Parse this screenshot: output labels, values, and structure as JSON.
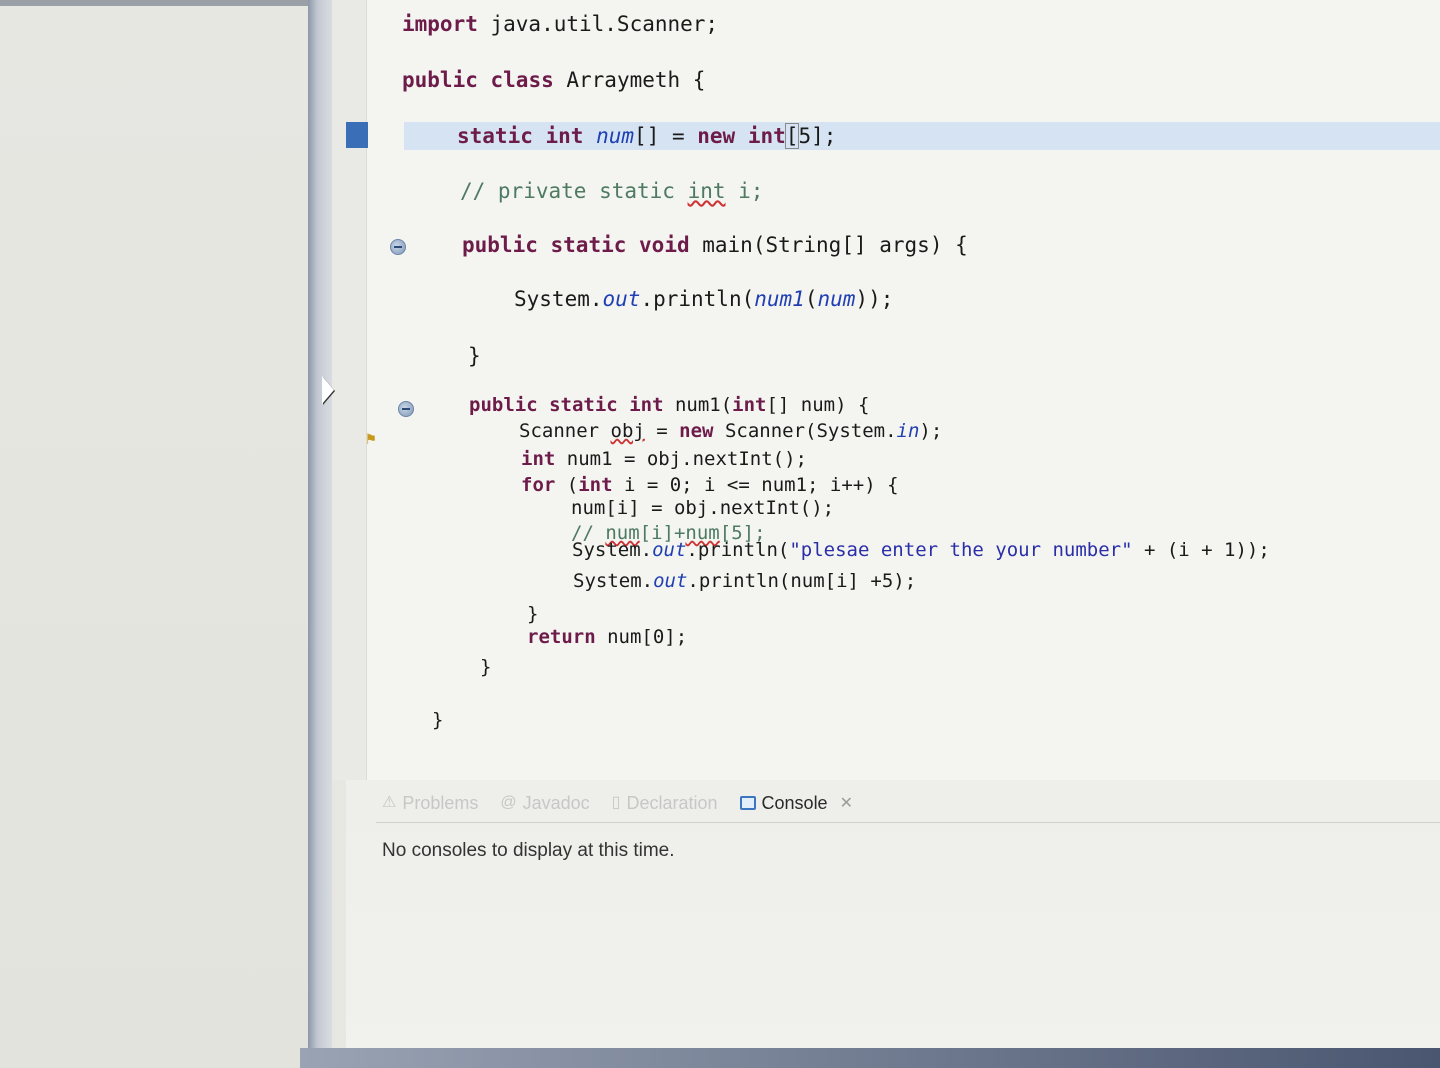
{
  "editor": {
    "lines": [
      {
        "id": "l1",
        "segments": [
          {
            "t": "import",
            "c": "kw"
          },
          {
            "t": " java.util.Scanner;",
            "c": ""
          }
        ]
      },
      {
        "id": "l2",
        "segments": [
          {
            "t": "public",
            "c": "kw"
          },
          {
            "t": " ",
            "c": ""
          },
          {
            "t": "class",
            "c": "kw"
          },
          {
            "t": " Arraymeth {",
            "c": ""
          }
        ]
      },
      {
        "id": "l3",
        "segments": [
          {
            "t": "static",
            "c": "kw"
          },
          {
            "t": " ",
            "c": ""
          },
          {
            "t": "int",
            "c": "kw"
          },
          {
            "t": " ",
            "c": ""
          },
          {
            "t": "num",
            "c": "field"
          },
          {
            "t": "[] = ",
            "c": ""
          },
          {
            "t": "new",
            "c": "kw"
          },
          {
            "t": " ",
            "c": ""
          },
          {
            "t": "int",
            "c": "kw"
          },
          {
            "t": "[",
            "c": "bracket-box"
          },
          {
            "t": "5];",
            "c": ""
          }
        ]
      },
      {
        "id": "l4",
        "segments": [
          {
            "t": "// private static ",
            "c": "comment"
          },
          {
            "t": "int",
            "c": "comment squiggle"
          },
          {
            "t": " i;",
            "c": "comment"
          }
        ]
      },
      {
        "id": "l5",
        "segments": [
          {
            "t": "public",
            "c": "kw"
          },
          {
            "t": " ",
            "c": ""
          },
          {
            "t": "static",
            "c": "kw"
          },
          {
            "t": " ",
            "c": ""
          },
          {
            "t": "void",
            "c": "kw"
          },
          {
            "t": " main(String[] args) {",
            "c": ""
          }
        ]
      },
      {
        "id": "l6",
        "segments": [
          {
            "t": "System.",
            "c": ""
          },
          {
            "t": "out",
            "c": "field"
          },
          {
            "t": ".println(",
            "c": ""
          },
          {
            "t": "num1",
            "c": "field"
          },
          {
            "t": "(",
            "c": ""
          },
          {
            "t": "num",
            "c": "field"
          },
          {
            "t": "));",
            "c": ""
          }
        ]
      },
      {
        "id": "l7",
        "segments": [
          {
            "t": "}",
            "c": ""
          }
        ]
      },
      {
        "id": "l8",
        "segments": [
          {
            "t": "public",
            "c": "kw"
          },
          {
            "t": " ",
            "c": ""
          },
          {
            "t": "static",
            "c": "kw"
          },
          {
            "t": " ",
            "c": ""
          },
          {
            "t": "int",
            "c": "kw"
          },
          {
            "t": " num1(",
            "c": ""
          },
          {
            "t": "int",
            "c": "kw"
          },
          {
            "t": "[] num) {",
            "c": ""
          }
        ]
      },
      {
        "id": "l9",
        "segments": [
          {
            "t": "Scanner ",
            "c": ""
          },
          {
            "t": "obj",
            "c": "squiggle"
          },
          {
            "t": " = ",
            "c": ""
          },
          {
            "t": "new",
            "c": "kw"
          },
          {
            "t": " Scanner(System.",
            "c": ""
          },
          {
            "t": "in",
            "c": "field"
          },
          {
            "t": ");",
            "c": ""
          }
        ]
      },
      {
        "id": "l10",
        "segments": [
          {
            "t": "int",
            "c": "kw"
          },
          {
            "t": " num1 = obj.nextInt();",
            "c": ""
          }
        ]
      },
      {
        "id": "l11",
        "segments": [
          {
            "t": "for",
            "c": "kw"
          },
          {
            "t": " (",
            "c": ""
          },
          {
            "t": "int",
            "c": "kw"
          },
          {
            "t": " i = 0; i <= num1; i++) {",
            "c": ""
          }
        ]
      },
      {
        "id": "l12",
        "segments": [
          {
            "t": "num[i] = obj.nextInt();",
            "c": ""
          }
        ]
      },
      {
        "id": "l13",
        "segments": [
          {
            "t": "// ",
            "c": "comment"
          },
          {
            "t": "num",
            "c": "comment squiggle"
          },
          {
            "t": "[i]+",
            "c": "comment"
          },
          {
            "t": "num",
            "c": "comment squiggle"
          },
          {
            "t": "[5];",
            "c": "comment"
          }
        ]
      },
      {
        "id": "l14",
        "segments": [
          {
            "t": "System.",
            "c": ""
          },
          {
            "t": "out",
            "c": "field"
          },
          {
            "t": ".println(",
            "c": ""
          },
          {
            "t": "\"plesae enter the your number\"",
            "c": "str"
          },
          {
            "t": " + (i + 1));",
            "c": ""
          }
        ]
      },
      {
        "id": "l15",
        "segments": [
          {
            "t": "System.",
            "c": ""
          },
          {
            "t": "out",
            "c": "field"
          },
          {
            "t": ".println(num[i] +5);",
            "c": ""
          }
        ]
      },
      {
        "id": "l16",
        "segments": [
          {
            "t": "}",
            "c": ""
          }
        ]
      },
      {
        "id": "l17",
        "segments": [
          {
            "t": "return",
            "c": "kw"
          },
          {
            "t": " num[0];",
            "c": ""
          }
        ]
      },
      {
        "id": "l18",
        "segments": [
          {
            "t": "}",
            "c": ""
          }
        ]
      },
      {
        "id": "l19",
        "segments": [
          {
            "t": "}",
            "c": ""
          }
        ]
      }
    ]
  },
  "panel": {
    "tabs": [
      {
        "id": "problems",
        "label": "Problems",
        "icon": "problems-icon",
        "icon_glyph": "⚠"
      },
      {
        "id": "javadoc",
        "label": "Javadoc",
        "icon": "javadoc-icon",
        "icon_glyph": "@"
      },
      {
        "id": "declaration",
        "label": "Declaration",
        "icon": "declaration-icon",
        "icon_glyph": "▯"
      },
      {
        "id": "console",
        "label": "Console",
        "icon": "console-icon",
        "icon_glyph": "",
        "active": true
      }
    ],
    "close_glyph": "✕",
    "message": "No consoles to display at this time."
  },
  "colors": {
    "keyword": "#6d1c4a",
    "field": "#1f3fb3",
    "comment": "#4d7a60",
    "string": "#2a2fa8",
    "current_line": "#d5e3f2",
    "bookmark": "#3a6fb8"
  }
}
